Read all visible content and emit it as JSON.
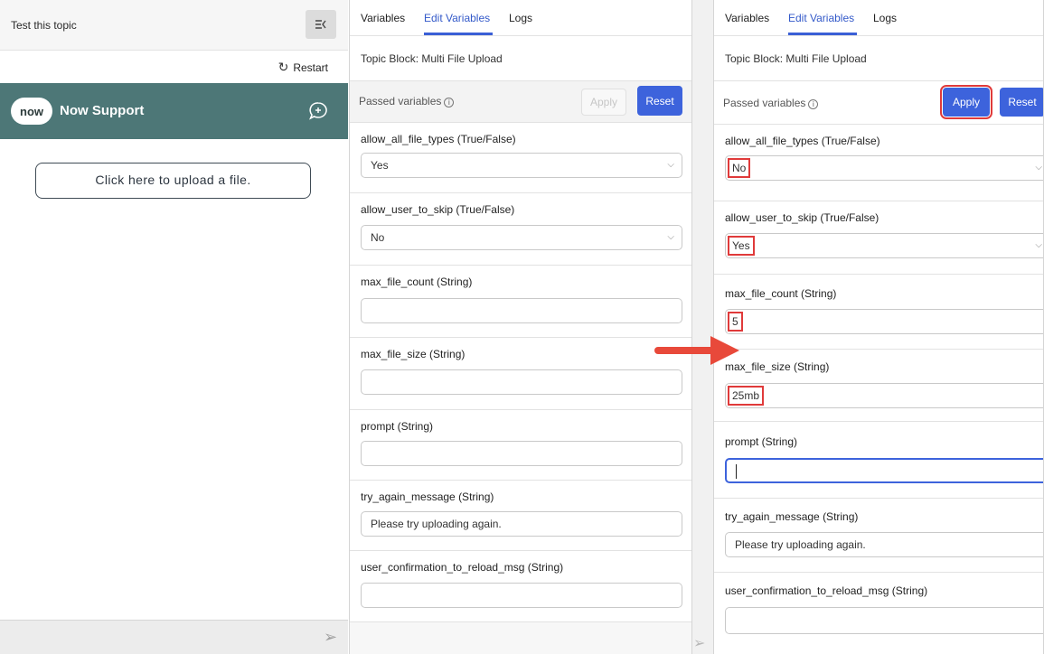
{
  "chat": {
    "title": "Test this topic",
    "restart_label": "Restart",
    "restart_glyph": "↻",
    "logo_text": "now",
    "support_name": "Now Support",
    "upload_button": "Click here to upload a file.",
    "send_glyph": "➢"
  },
  "panel_left": {
    "tabs": [
      "Variables",
      "Edit Variables",
      "Logs"
    ],
    "topic_block": "Topic Block:  Multi File Upload",
    "passed_variables": "Passed variables",
    "apply_label": "Apply",
    "reset_label": "Reset",
    "fields": [
      {
        "label": "allow_all_file_types (True/False)",
        "value": "Yes"
      },
      {
        "label": "allow_user_to_skip (True/False)",
        "value": "No"
      },
      {
        "label": "max_file_count (String)",
        "value": ""
      },
      {
        "label": "max_file_size (String)",
        "value": ""
      },
      {
        "label": "prompt (String)",
        "value": ""
      },
      {
        "label": "try_again_message (String)",
        "value": "Please try uploading again."
      },
      {
        "label": "user_confirmation_to_reload_msg (String)",
        "value": ""
      }
    ]
  },
  "panel_right": {
    "tabs": [
      "Variables",
      "Edit Variables",
      "Logs"
    ],
    "topic_block": "Topic Block:  Multi File Upload",
    "passed_variables": "Passed variables",
    "apply_label": "Apply",
    "reset_label": "Reset",
    "fields": [
      {
        "label": "allow_all_file_types (True/False)",
        "value": "No"
      },
      {
        "label": "allow_user_to_skip (True/False)",
        "value": "Yes"
      },
      {
        "label": "max_file_count (String)",
        "value": "5"
      },
      {
        "label": "max_file_size (String)",
        "value": "25mb"
      },
      {
        "label": "prompt (String)",
        "value": ""
      },
      {
        "label": "try_again_message (String)",
        "value": "Please try uploading again."
      },
      {
        "label": "user_confirmation_to_reload_msg (String)",
        "value": ""
      }
    ]
  },
  "colors": {
    "header_teal": "#4d7777",
    "primary_blue": "#3d63dc",
    "highlight_red": "#e03a3a"
  }
}
